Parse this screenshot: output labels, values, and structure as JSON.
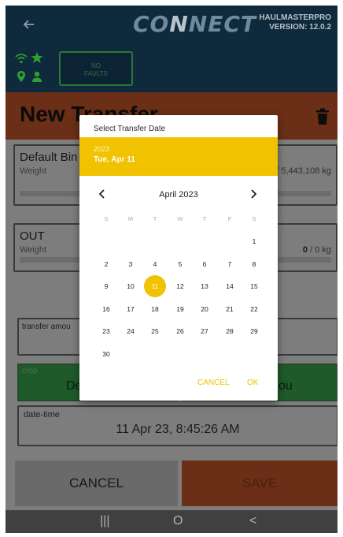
{
  "app": {
    "logo": {
      "pre": "CO",
      "hl": "N",
      "post": "NECT"
    },
    "name": "HAULMASTERPRO",
    "version": "VERSION: 12.0.2"
  },
  "status": {
    "faults_line1": "NO",
    "faults_line2": "FAULTS"
  },
  "page": {
    "title": "New Transfer"
  },
  "cards": {
    "from_title": "Default Bin",
    "from_sub": "Weight",
    "from_value": "/ 5,443,108 kg",
    "to_title": "OUT",
    "to_sub": "Weight",
    "to_value_bold": "0",
    "to_value_rest": " / 0 kg",
    "amount_label": "transfer amou",
    "crop_label": "crop",
    "crop_value": "De",
    "crop_value_right": "ou"
  },
  "datetime": {
    "label": "date-time",
    "value": "11 Apr 23, 8:45:26 AM"
  },
  "buttons": {
    "cancel": "CANCEL",
    "save": "SAVE"
  },
  "navbar": {
    "recents": "|||",
    "home": "O",
    "back": "<"
  },
  "dialog": {
    "title": "Select Transfer Date",
    "year": "2023",
    "selected": "Tue, Apr 11",
    "month": "April 2023",
    "weekdays": [
      "S",
      "M",
      "T",
      "W",
      "T",
      "F",
      "S"
    ],
    "weeks": [
      [
        "",
        "",
        "",
        "",
        "",
        "",
        "1"
      ],
      [
        "2",
        "3",
        "4",
        "5",
        "6",
        "7",
        "8"
      ],
      [
        "9",
        "10",
        "11",
        "12",
        "13",
        "14",
        "15"
      ],
      [
        "16",
        "17",
        "18",
        "19",
        "20",
        "21",
        "22"
      ],
      [
        "23",
        "24",
        "25",
        "26",
        "27",
        "28",
        "29"
      ],
      [
        "30",
        "",
        "",
        "",
        "",
        "",
        ""
      ]
    ],
    "selected_day": "11",
    "cancel": "CANCEL",
    "ok": "OK"
  },
  "colors": {
    "accent": "#f0c200",
    "topbar": "#0e2a3c",
    "orange": "#6b2e16",
    "green": "#1e5a2a"
  },
  "icons": [
    "back-arrow-icon",
    "wifi-icon",
    "star-icon",
    "location-pin-icon",
    "person-icon",
    "trash-icon",
    "chevron-left-icon",
    "chevron-right-icon"
  ]
}
